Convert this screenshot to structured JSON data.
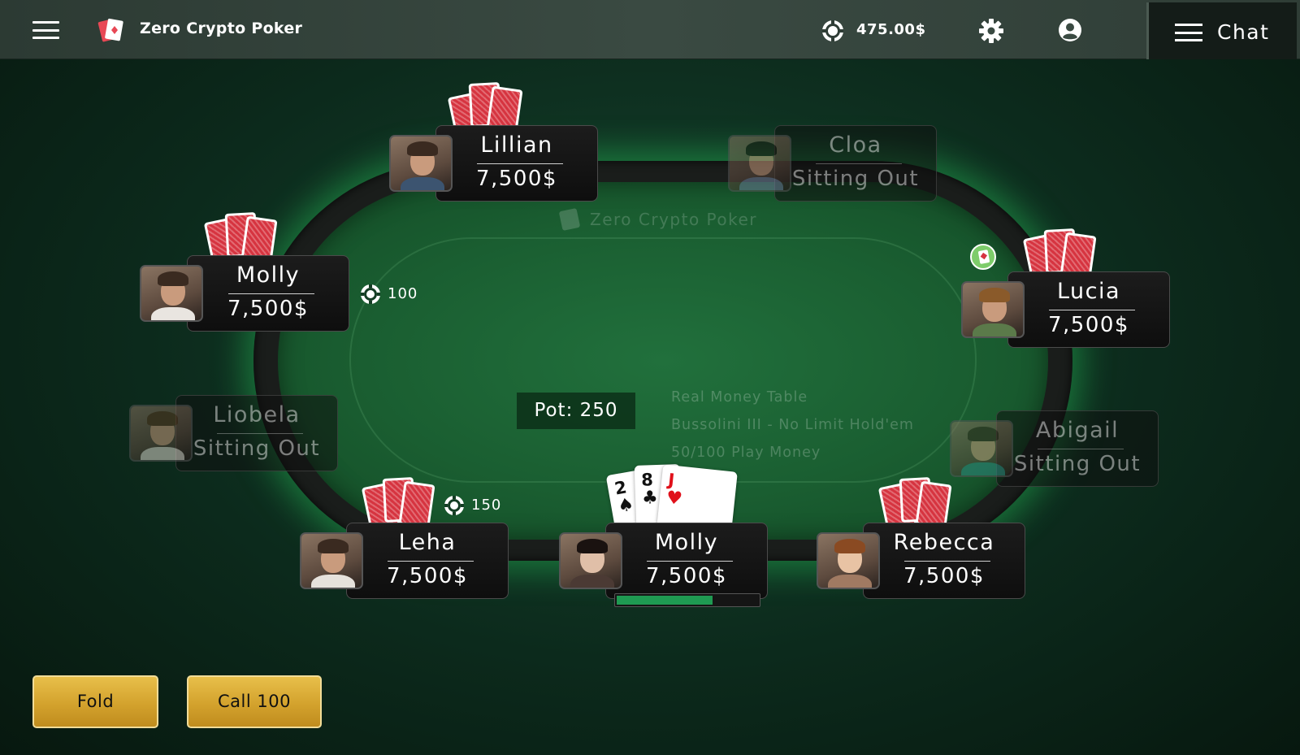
{
  "header": {
    "app_title": "Zero Crypto Poker",
    "balance": "475.00$",
    "chat_label": "Chat",
    "icons": {
      "menu": "hamburger-icon",
      "logo": "playing-cards-logo",
      "balance": "chip-icon",
      "settings": "gear-icon",
      "account": "user-circle-icon",
      "chat_menu": "hamburger-icon"
    }
  },
  "table": {
    "brand": "Zero Crypto Poker",
    "pot_label": "Pot: 250",
    "info_line1": "Real Money Table",
    "info_line2": "Bussolini III - No Limit Hold'em",
    "info_line3": "50/100 Play Money"
  },
  "seats": {
    "lillian": {
      "name": "Lillian",
      "stack": "7,500$"
    },
    "cloa": {
      "name": "Cloa",
      "stack": "Sitting Out"
    },
    "molly_left": {
      "name": "Molly",
      "stack": "7,500$",
      "bet": "100"
    },
    "lucia": {
      "name": "Lucia",
      "stack": "7,500$"
    },
    "liobela": {
      "name": "Liobela",
      "stack": "Sitting Out"
    },
    "abigail": {
      "name": "Abigail",
      "stack": "Sitting Out"
    },
    "leha": {
      "name": "Leha",
      "stack": "7,500$",
      "bet": "150"
    },
    "molly_hero": {
      "name": "Molly",
      "stack": "7,500$",
      "timer_fraction": 0.68,
      "hand": [
        {
          "rank": "2",
          "suit": "♠",
          "color": "#111111"
        },
        {
          "rank": "8",
          "suit": "♣",
          "color": "#111111"
        },
        {
          "rank": "J",
          "suit": "♥",
          "color": "#e0101a"
        }
      ]
    },
    "rebecca": {
      "name": "Rebecca",
      "stack": "7,500$"
    }
  },
  "actions": {
    "fold": "Fold",
    "call": "Call 100"
  },
  "colors": {
    "felt": "#1a5e31",
    "glow": "#28c85a",
    "button_gold": "#d3a22d",
    "timer": "#1f9a52"
  }
}
